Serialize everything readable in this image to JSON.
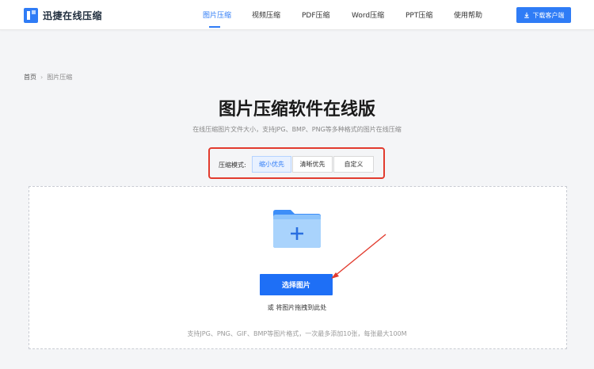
{
  "header": {
    "logo_text": "迅捷在线压缩",
    "nav": [
      {
        "label": "图片压缩",
        "active": true
      },
      {
        "label": "视频压缩",
        "active": false
      },
      {
        "label": "PDF压缩",
        "active": false
      },
      {
        "label": "Word压缩",
        "active": false
      },
      {
        "label": "PPT压缩",
        "active": false
      },
      {
        "label": "使用帮助",
        "active": false
      }
    ],
    "download_label": "下载客户端"
  },
  "breadcrumb": {
    "home": "首页",
    "current": "图片压缩"
  },
  "main": {
    "title": "图片压缩软件在线版",
    "subtitle": "在线压缩图片文件大小，支持JPG、BMP、PNG等多种格式的图片在线压缩"
  },
  "mode": {
    "label": "压缩模式:",
    "options": [
      "缩小优先",
      "清晰优先",
      "自定义"
    ],
    "selected": "缩小优先"
  },
  "upload": {
    "button_label": "选择图片",
    "drag_text": "或 将图片拖拽到此处",
    "support_text": "支持JPG、PNG、GIF、BMP等图片格式，一次最多添加10张，每张最大100M"
  },
  "colors": {
    "accent": "#2f7cf6",
    "annotation": "#e23b2e"
  }
}
